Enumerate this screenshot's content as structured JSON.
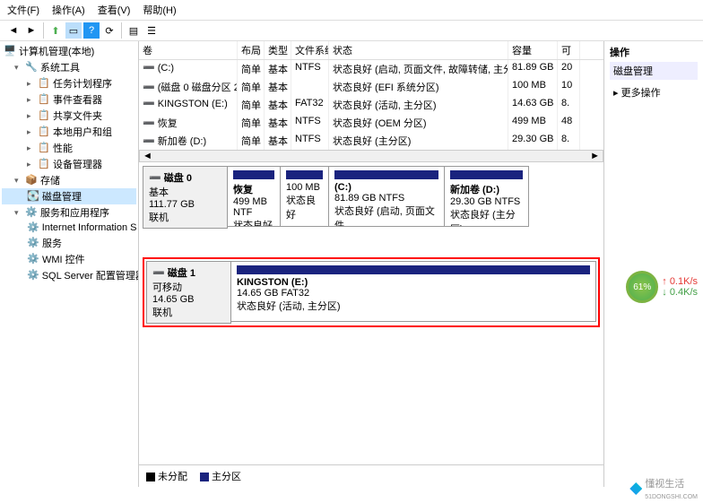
{
  "menu": {
    "file": "文件(F)",
    "action": "操作(A)",
    "view": "查看(V)",
    "help": "帮助(H)"
  },
  "tree": {
    "root": "计算机管理(本地)",
    "systools": "系统工具",
    "systools_items": [
      "任务计划程序",
      "事件查看器",
      "共享文件夹",
      "本地用户和组",
      "性能",
      "设备管理器"
    ],
    "storage": "存储",
    "diskmgmt": "磁盘管理",
    "services": "服务和应用程序",
    "services_items": [
      "Internet Information S",
      "服务",
      "WMI 控件",
      "SQL Server 配置管理器"
    ]
  },
  "vol_head": {
    "vol": "卷",
    "lay": "布局",
    "typ": "类型",
    "fs": "文件系统",
    "sta": "状态",
    "cap": "容量",
    "av": "可"
  },
  "vols": [
    {
      "name": "(C:)",
      "lay": "简单",
      "typ": "基本",
      "fs": "NTFS",
      "sta": "状态良好 (启动, 页面文件, 故障转储, 主分区)",
      "cap": "81.89 GB",
      "av": "20"
    },
    {
      "name": "(磁盘 0 磁盘分区 2)",
      "lay": "简单",
      "typ": "基本",
      "fs": "",
      "sta": "状态良好 (EFI 系统分区)",
      "cap": "100 MB",
      "av": "10"
    },
    {
      "name": "KINGSTON (E:)",
      "lay": "简单",
      "typ": "基本",
      "fs": "FAT32",
      "sta": "状态良好 (活动, 主分区)",
      "cap": "14.63 GB",
      "av": "8."
    },
    {
      "name": "恢复",
      "lay": "简单",
      "typ": "基本",
      "fs": "NTFS",
      "sta": "状态良好 (OEM 分区)",
      "cap": "499 MB",
      "av": "48"
    },
    {
      "name": "新加卷 (D:)",
      "lay": "简单",
      "typ": "基本",
      "fs": "NTFS",
      "sta": "状态良好 (主分区)",
      "cap": "29.30 GB",
      "av": "8."
    }
  ],
  "disk0": {
    "title": "磁盘 0",
    "type": "基本",
    "size": "111.77 GB",
    "state": "联机",
    "parts": [
      {
        "name": "恢复",
        "info": "499 MB NTF",
        "sta": "状态良好 (OE",
        "w": 60
      },
      {
        "name": "",
        "info": "100 MB",
        "sta": "状态良好",
        "w": 55
      },
      {
        "name": "(C:)",
        "info": "81.89 GB NTFS",
        "sta": "状态良好 (启动, 页面文件, ",
        "w": 130
      },
      {
        "name": "新加卷  (D:)",
        "info": "29.30 GB NTFS",
        "sta": "状态良好 (主分区)",
        "w": 95
      }
    ]
  },
  "disk1": {
    "title": "磁盘 1",
    "type": "可移动",
    "size": "14.65 GB",
    "state": "联机",
    "part": {
      "name": "KINGSTON  (E:)",
      "info": "14.65 GB FAT32",
      "sta": "状态良好 (活动, 主分区)"
    }
  },
  "legend": {
    "unalloc": "未分配",
    "primary": "主分区"
  },
  "actions": {
    "title": "操作",
    "dm": "磁盘管理",
    "more": "更多操作"
  },
  "widget": {
    "pct": "61%",
    "up": "0.1K/s",
    "dn": "0.4K/s"
  },
  "wm": {
    "text": "懂视生活",
    "sub": "51DONGSHI.COM"
  }
}
